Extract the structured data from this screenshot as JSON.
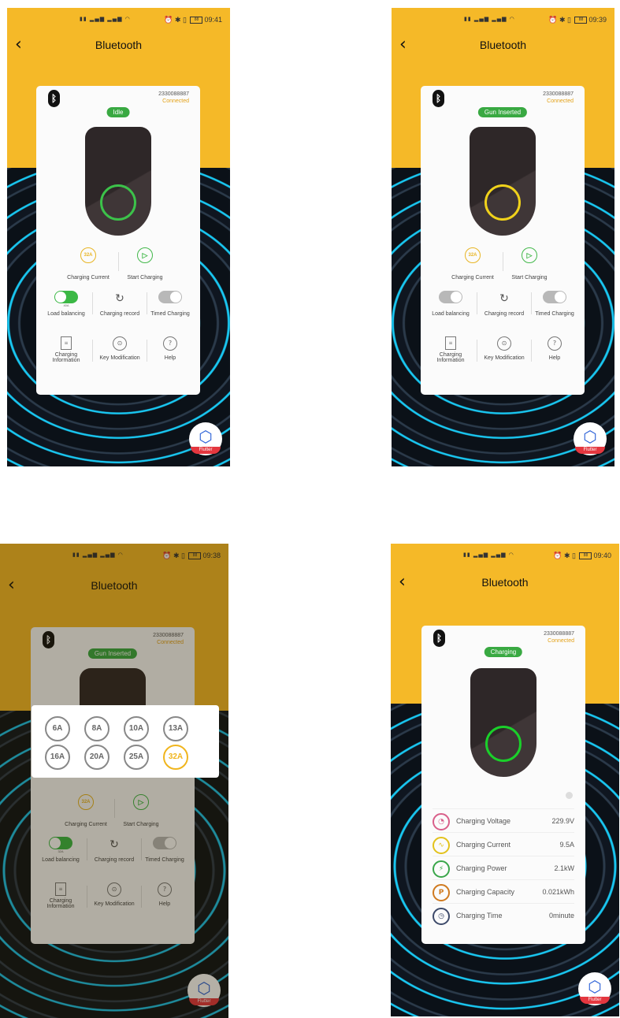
{
  "common": {
    "title": "Bluetooth",
    "device_id": "2330088887",
    "connection": "Connected",
    "flutter_label": "Flutter"
  },
  "panels": [
    {
      "time": "09:41",
      "status": "Idle",
      "battery": "88",
      "current_label": "32A",
      "load_sub": "40A",
      "load_on": true
    },
    {
      "time": "09:39",
      "status": "Gun Inserted",
      "battery": "88",
      "current_label": "32A",
      "load_sub": "",
      "load_on": false
    },
    {
      "time": "09:38",
      "status": "Gun Inserted",
      "battery": "88",
      "current_label": "32A",
      "load_sub": "32A",
      "load_on": true
    },
    {
      "time": "09:40",
      "status": "Charging",
      "battery": "88"
    }
  ],
  "buttons": {
    "charging_current": "Charging Current",
    "start_charging": "Start Charging",
    "load_balancing": "Load balancing",
    "charging_record": "Charging record",
    "timed_charging": "Timed Charging",
    "charging_information_1": "Charging",
    "charging_information_2": "Information",
    "key_modification": "Key Modification",
    "help": "Help"
  },
  "amp_options": [
    "6A",
    "8A",
    "10A",
    "13A",
    "16A",
    "20A",
    "25A",
    "32A"
  ],
  "amp_selected": "32A",
  "readings": [
    {
      "label": "Charging Voltage",
      "value": "229.9V",
      "color": "#d95f8a",
      "icon": "gauge-icon"
    },
    {
      "label": "Charging Current",
      "value": "9.5A",
      "color": "#e3c21b",
      "icon": "waveform-icon"
    },
    {
      "label": "Charging Power",
      "value": "2.1kW",
      "color": "#3aa64a",
      "icon": "plug-icon"
    },
    {
      "label": "Charging Capacity",
      "value": "0.021kWh",
      "color": "#d07a1f",
      "icon": "parking-icon"
    },
    {
      "label": "Charging Time",
      "value": "0minute",
      "color": "#3d4a6a",
      "icon": "clock-icon"
    }
  ],
  "colors": {
    "brand_yellow": "#f5b928",
    "status_green": "#39a942",
    "accent_amber": "#e3a21a"
  }
}
